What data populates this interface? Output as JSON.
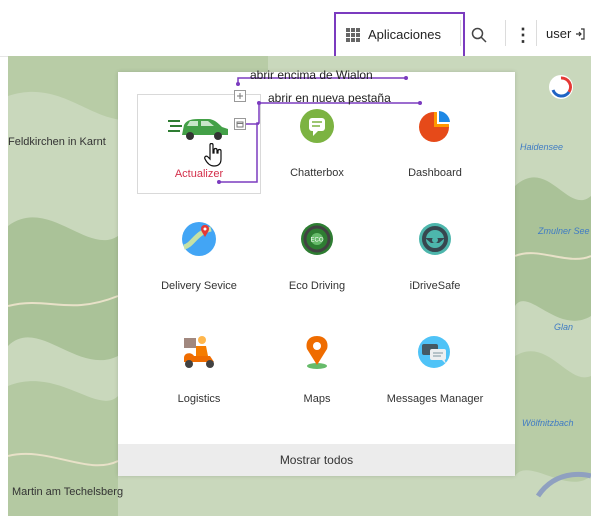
{
  "topbar": {
    "apps_label": "Aplicaciones",
    "user_label": "user"
  },
  "map": {
    "labels": [
      "Feldkirchen in Karnt",
      "Martin am Techelsberg",
      "Haidensee",
      "Zmulner See",
      "Glan",
      "Wölfnitzbach"
    ]
  },
  "annotations": {
    "open_over": "abrir encima de Wialon",
    "open_new_tab": "abrir en nueva pestaña"
  },
  "apps": [
    {
      "label": "Actualizer",
      "icon": "green-car-icon"
    },
    {
      "label": "Chatterbox",
      "icon": "chat-bubble-icon"
    },
    {
      "label": "Dashboard",
      "icon": "pie-chart-icon"
    },
    {
      "label": "Delivery Sevice",
      "icon": "map-route-icon"
    },
    {
      "label": "Eco Driving",
      "icon": "eco-steering-wheel-icon"
    },
    {
      "label": "iDriveSafe",
      "icon": "steering-wheel-icon"
    },
    {
      "label": "Logistics",
      "icon": "delivery-scooter-icon"
    },
    {
      "label": "Maps",
      "icon": "map-pin-icon"
    },
    {
      "label": "Messages Manager",
      "icon": "message-bubbles-icon"
    }
  ],
  "show_all_label": "Mostrar todos",
  "colors": {
    "highlight_border": "#7b3bbf",
    "active_label": "#d32f4a"
  }
}
